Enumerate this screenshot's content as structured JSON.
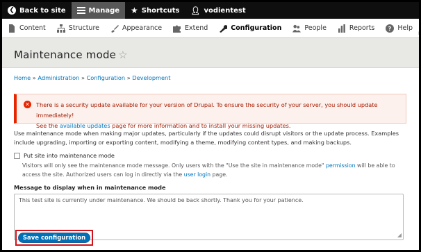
{
  "toolbar": {
    "back_label": "Back to site",
    "manage_label": "Manage",
    "shortcuts_label": "Shortcuts",
    "user_label": "vodientest"
  },
  "tray": {
    "items": [
      {
        "label": "Content",
        "icon": "document-icon"
      },
      {
        "label": "Structure",
        "icon": "structure-icon"
      },
      {
        "label": "Appearance",
        "icon": "brush-icon"
      },
      {
        "label": "Extend",
        "icon": "puzzle-icon"
      },
      {
        "label": "Configuration",
        "icon": "wrench-icon"
      },
      {
        "label": "People",
        "icon": "people-icon"
      },
      {
        "label": "Reports",
        "icon": "bar-chart-icon"
      },
      {
        "label": "Help",
        "icon": "help-icon"
      }
    ]
  },
  "page": {
    "title": "Maintenance mode"
  },
  "breadcrumb": {
    "items": [
      "Home",
      "Administration",
      "Configuration",
      "Development"
    ],
    "separator": "»"
  },
  "alert": {
    "text1": "There is a security update available for your version of Drupal. To ensure the security of your server, you should update immediately!",
    "text2_pre": "See the ",
    "text2_link": "available updates",
    "text2_post": " page for more information and to install your missing updates."
  },
  "description": "Use maintenance mode when making major updates, particularly if the updates could disrupt visitors or the update process. Examples include upgrading, importing or exporting content, modifying a theme, modifying content types, and making backups.",
  "checkbox": {
    "label": "Put site into maintenance mode",
    "checked": false,
    "desc_pre": "Visitors will only see the maintenance mode message. Only users with the \"Use the site in maintenance mode\" ",
    "desc_link1": "permission",
    "desc_mid": " will be able to access the site. Authorized users can log in directly via the ",
    "desc_link2": "user login",
    "desc_post": " page."
  },
  "message": {
    "label": "Message to display when in maintenance mode",
    "value": "This test site is currently under maintenance. We should be back shortly. Thank you for your patience."
  },
  "save_label": "Save configuration",
  "colors": {
    "accent": "#0071b8",
    "error": "#e62600",
    "highlight": "#d0121b"
  }
}
